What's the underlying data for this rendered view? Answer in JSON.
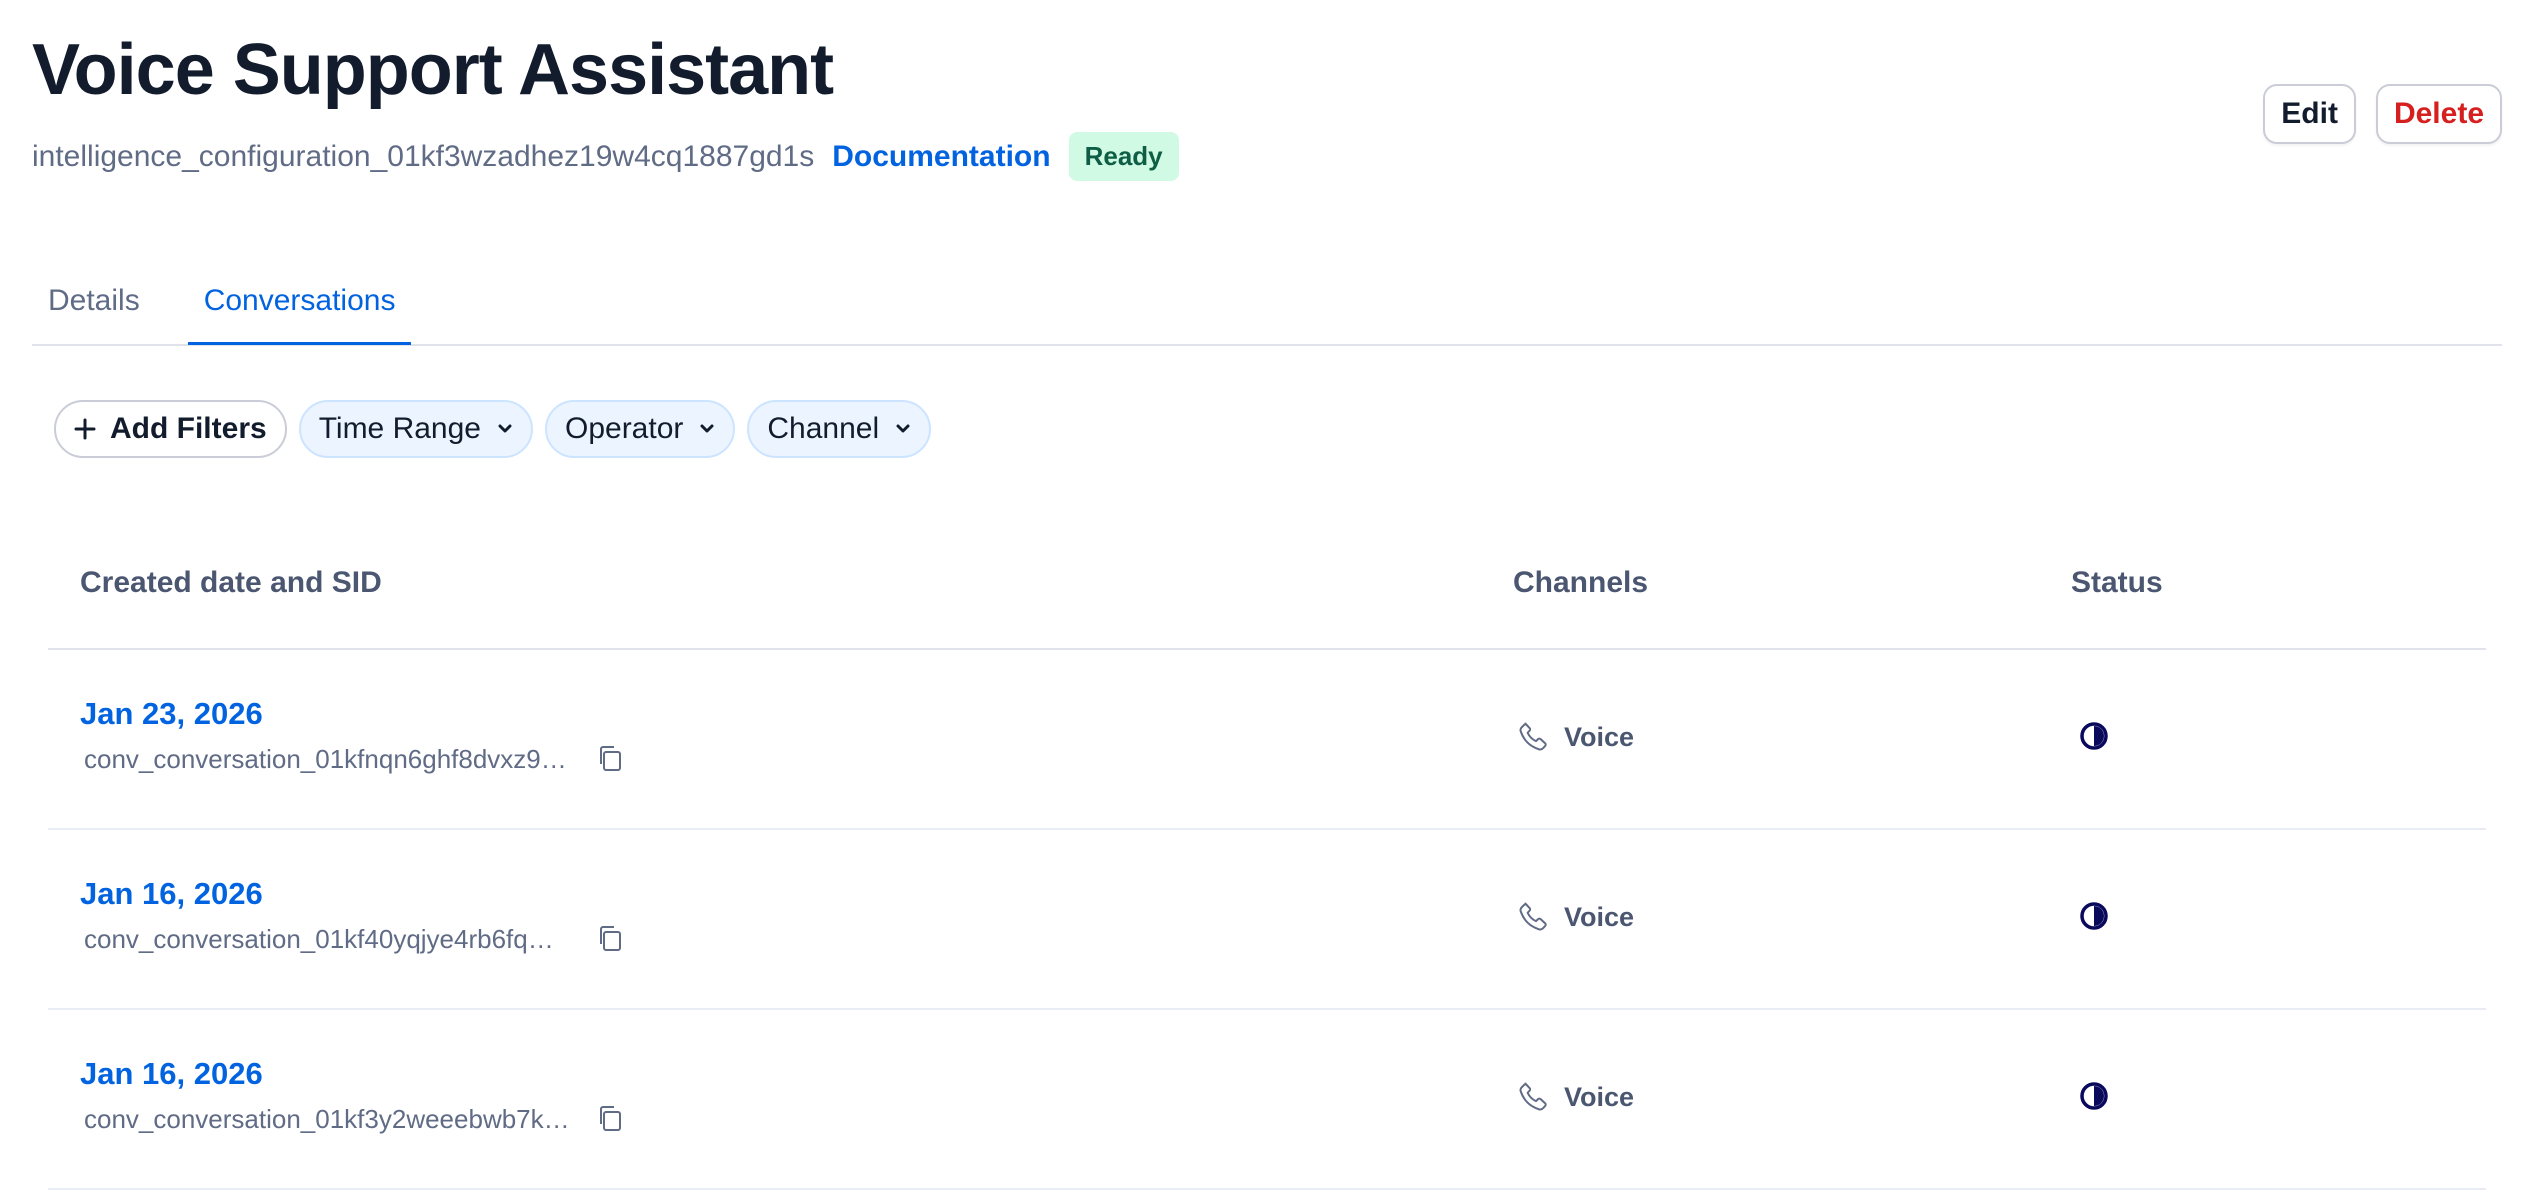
{
  "header": {
    "title": "Voice Support Assistant",
    "sid": "intelligence_configuration_01kf3wzadhez19w4cq1887gd1s",
    "documentation_label": "Documentation",
    "status_badge": "Ready",
    "edit_label": "Edit",
    "delete_label": "Delete"
  },
  "tabs": [
    {
      "label": "Details",
      "active": false
    },
    {
      "label": "Conversations",
      "active": true
    }
  ],
  "filters": {
    "add_label": "Add Filters",
    "dropdowns": [
      "Time Range",
      "Operator",
      "Channel"
    ]
  },
  "table": {
    "columns": [
      "Created date and SID",
      "Channels",
      "Status"
    ],
    "rows": [
      {
        "date": "Jan 23, 2026",
        "sid": "conv_conversation_01kfnqn6ghf8dvxz9…",
        "channel": "Voice",
        "status_icon": "in-progress-icon"
      },
      {
        "date": "Jan 16, 2026",
        "sid": "conv_conversation_01kf40yqjye4rb6fq…",
        "channel": "Voice",
        "status_icon": "in-progress-icon"
      },
      {
        "date": "Jan 16, 2026",
        "sid": "conv_conversation_01kf3y2weeebwb7k…",
        "channel": "Voice",
        "status_icon": "in-progress-icon"
      }
    ]
  },
  "colors": {
    "accent": "#0263e0",
    "danger": "#d61f1f",
    "ready_bg": "#d1fae5",
    "status_icon": "#0a0a5c"
  }
}
